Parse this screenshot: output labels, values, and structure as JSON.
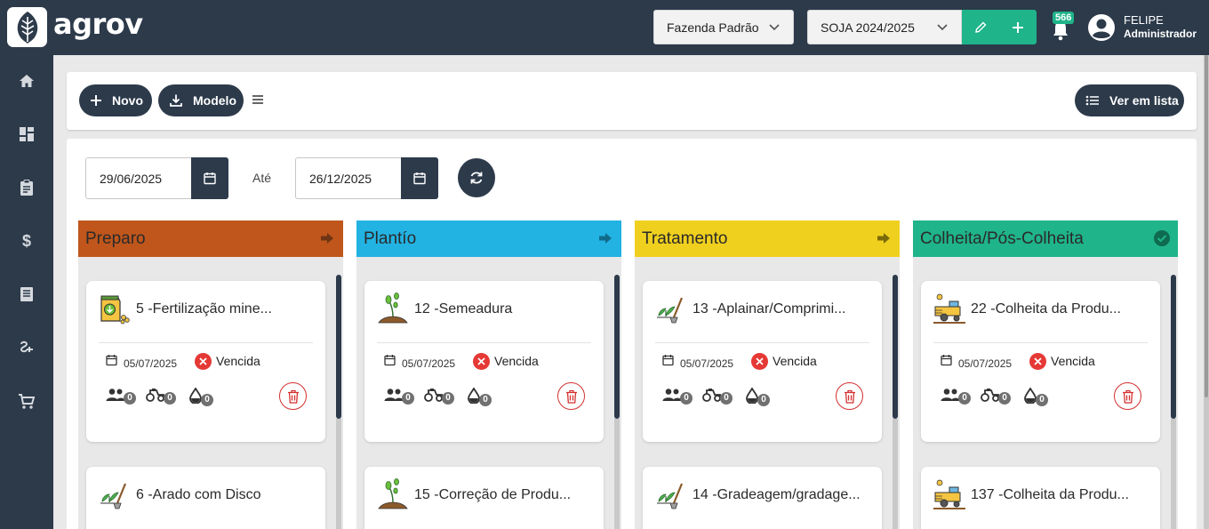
{
  "app": {
    "logo_text": "agrov"
  },
  "header": {
    "farm_select": "Fazenda Padrão",
    "season_select": "SOJA 2024/2025",
    "notification_count": "566",
    "user_name": "FELIPE",
    "user_role": "Administrador"
  },
  "sidebar": {
    "items": [
      {
        "icon": "home-icon"
      },
      {
        "icon": "dashboard-icon"
      },
      {
        "icon": "clipboard-icon"
      },
      {
        "icon": "dollar-icon"
      },
      {
        "icon": "book-icon"
      },
      {
        "icon": "plug-icon"
      },
      {
        "icon": "cart-icon"
      }
    ]
  },
  "toolbar": {
    "new_label": "Novo",
    "model_label": "Modelo",
    "list_label": "Ver em lista"
  },
  "filters": {
    "start_date": "29/06/2025",
    "until_label": "Até",
    "end_date": "26/12/2025"
  },
  "colors": {
    "dark": "#2c3a4a",
    "accent_green": "#1fb48a",
    "preparo": "#c0561b",
    "plantio": "#22b3e3",
    "tratamento": "#f0d01e",
    "colheita": "#1fb48a",
    "overdue": "#e53935"
  },
  "columns": [
    {
      "title": "Preparo",
      "cards": [
        {
          "title": "5 -Fertilização mine...",
          "icon": "fertilizer-icon",
          "date": "05/07/2025",
          "status": "Vencida",
          "people": "0",
          "machines": "0",
          "inputs": "0"
        },
        {
          "title": "6 -Arado com Disco",
          "icon": "plant-shovel-icon"
        }
      ]
    },
    {
      "title": "Plantío",
      "cards": [
        {
          "title": "12 -Semeadura",
          "icon": "sprout-icon",
          "date": "05/07/2025",
          "status": "Vencida",
          "people": "0",
          "machines": "0",
          "inputs": "0"
        },
        {
          "title": "15 -Correção de Produ...",
          "icon": "sprout-icon"
        }
      ]
    },
    {
      "title": "Tratamento",
      "cards": [
        {
          "title": "13 -Aplainar/Comprimi...",
          "icon": "plant-shovel-icon",
          "date": "05/07/2025",
          "status": "Vencida",
          "people": "0",
          "machines": "0",
          "inputs": "0"
        },
        {
          "title": "14 -Gradeagem/gradage...",
          "icon": "plant-shovel-icon"
        }
      ]
    },
    {
      "title": "Colheita/Pós-Colheita",
      "cards": [
        {
          "title": "22 -Colheita da Produ...",
          "icon": "harvester-icon",
          "date": "05/07/2025",
          "status": "Vencida",
          "people": "0",
          "machines": "0",
          "inputs": "0"
        },
        {
          "title": "137 -Colheita da Produ...",
          "icon": "harvester-icon"
        }
      ]
    }
  ]
}
